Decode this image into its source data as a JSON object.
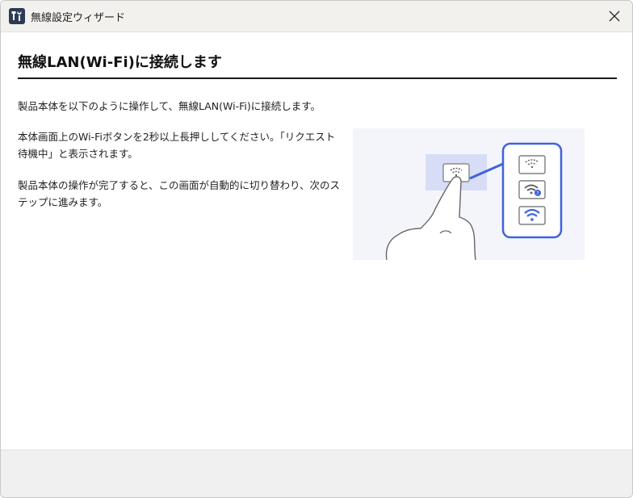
{
  "window": {
    "title": "無線設定ウィザード"
  },
  "main": {
    "heading": "無線LAN(Wi-Fi)に接続します",
    "paragraph1": "製品本体を以下のように操作して、無線LAN(Wi-Fi)に接続します。",
    "paragraph2": "本体画面上のWi-Fiボタンを2秒以上長押ししてください。「リクエスト待機中」と表示されます。",
    "paragraph3": "製品本体の操作が完了すると、この画面が自動的に切り替わり、次のステップに進みます。"
  },
  "illustration": {
    "icons": [
      "wifi-searching-icon",
      "wifi-waiting-icon",
      "wifi-connected-icon"
    ],
    "accent_color": "#3e63dd",
    "highlight_color": "#d7ddf7"
  },
  "icons": {
    "app": "tools-icon",
    "close": "close-icon"
  }
}
